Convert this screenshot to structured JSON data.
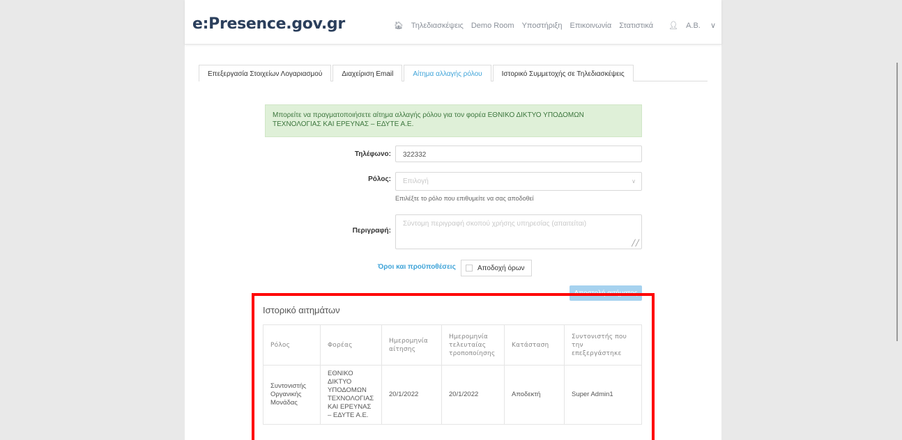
{
  "header": {
    "logo_prefix": "e",
    "logo_rest": ":Presence.gov.gr",
    "nav": [
      {
        "label": "Τηλεδιασκέψεις"
      },
      {
        "label": "Demo Room"
      },
      {
        "label": "Υποστήριξη"
      },
      {
        "label": "Επικοινωνία"
      },
      {
        "label": "Στατιστικά"
      }
    ],
    "user": "Α.Β."
  },
  "tabs": [
    {
      "label": "Επεξεργασία Στοιχείων Λογαριασμού"
    },
    {
      "label": "Διαχείριση Email"
    },
    {
      "label": "Αίτημα αλλαγής ρόλου"
    },
    {
      "label": "Ιστορικό Συμμετοχής σε Τηλεδιασκέψεις"
    }
  ],
  "alert": "Μπορείτε να πραγματοποιήσετε αίτημα αλλαγής ρόλου για τον φορέα ΕΘΝΙΚΟ ΔΙΚΤΥΟ ΥΠΟΔΟΜΩΝ ΤΕΧΝΟΛΟΓΙΑΣ ΚΑΙ ΕΡΕΥΝΑΣ – ΕΔΥΤΕ Α.Ε.",
  "form": {
    "phone_label": "Τηλέφωνο:",
    "phone_value": "322332",
    "role_label": "Ρόλος:",
    "role_placeholder": "Επιλογή",
    "role_help": "Επιλέξτε το ρόλο που επιθυμείτε να σας αποδοθεί",
    "description_label": "Περιγραφή:",
    "description_placeholder": "Σύντομη περιγραφή σκοπού χρήσης υπηρεσίας (απαιτείται)",
    "terms_link": "Όροι και προϋποθέσεις",
    "terms_accept": "Αποδοχή όρων",
    "submit": "Αποστολή αιτήματος"
  },
  "history": {
    "title": "Ιστορικό αιτημάτων",
    "columns": [
      "Ρόλος",
      "Φορέας",
      "Ημερομηνία αίτησης",
      "Ημερομηνία τελευταίας τροποποίησης",
      "Κατάσταση",
      "Συντονιστής που την επεξεργάστηκε"
    ],
    "rows": [
      [
        "Συντονιστής Οργανικής Μονάδας",
        "ΕΘΝΙΚΟ ΔΙΚΤΥΟ ΥΠΟΔΟΜΩΝ ΤΕΧΝΟΛΟΓΙΑΣ ΚΑΙ ΕΡΕΥΝΑΣ – ΕΔΥΤΕ Α.Ε.",
        "20/1/2022",
        "20/1/2022",
        "Αποδεκτή",
        "Super Admin1"
      ]
    ]
  },
  "colors": {
    "accent": "#3ea3d8",
    "highlight_frame": "#ff0000",
    "alert_bg": "#dff0d8"
  }
}
